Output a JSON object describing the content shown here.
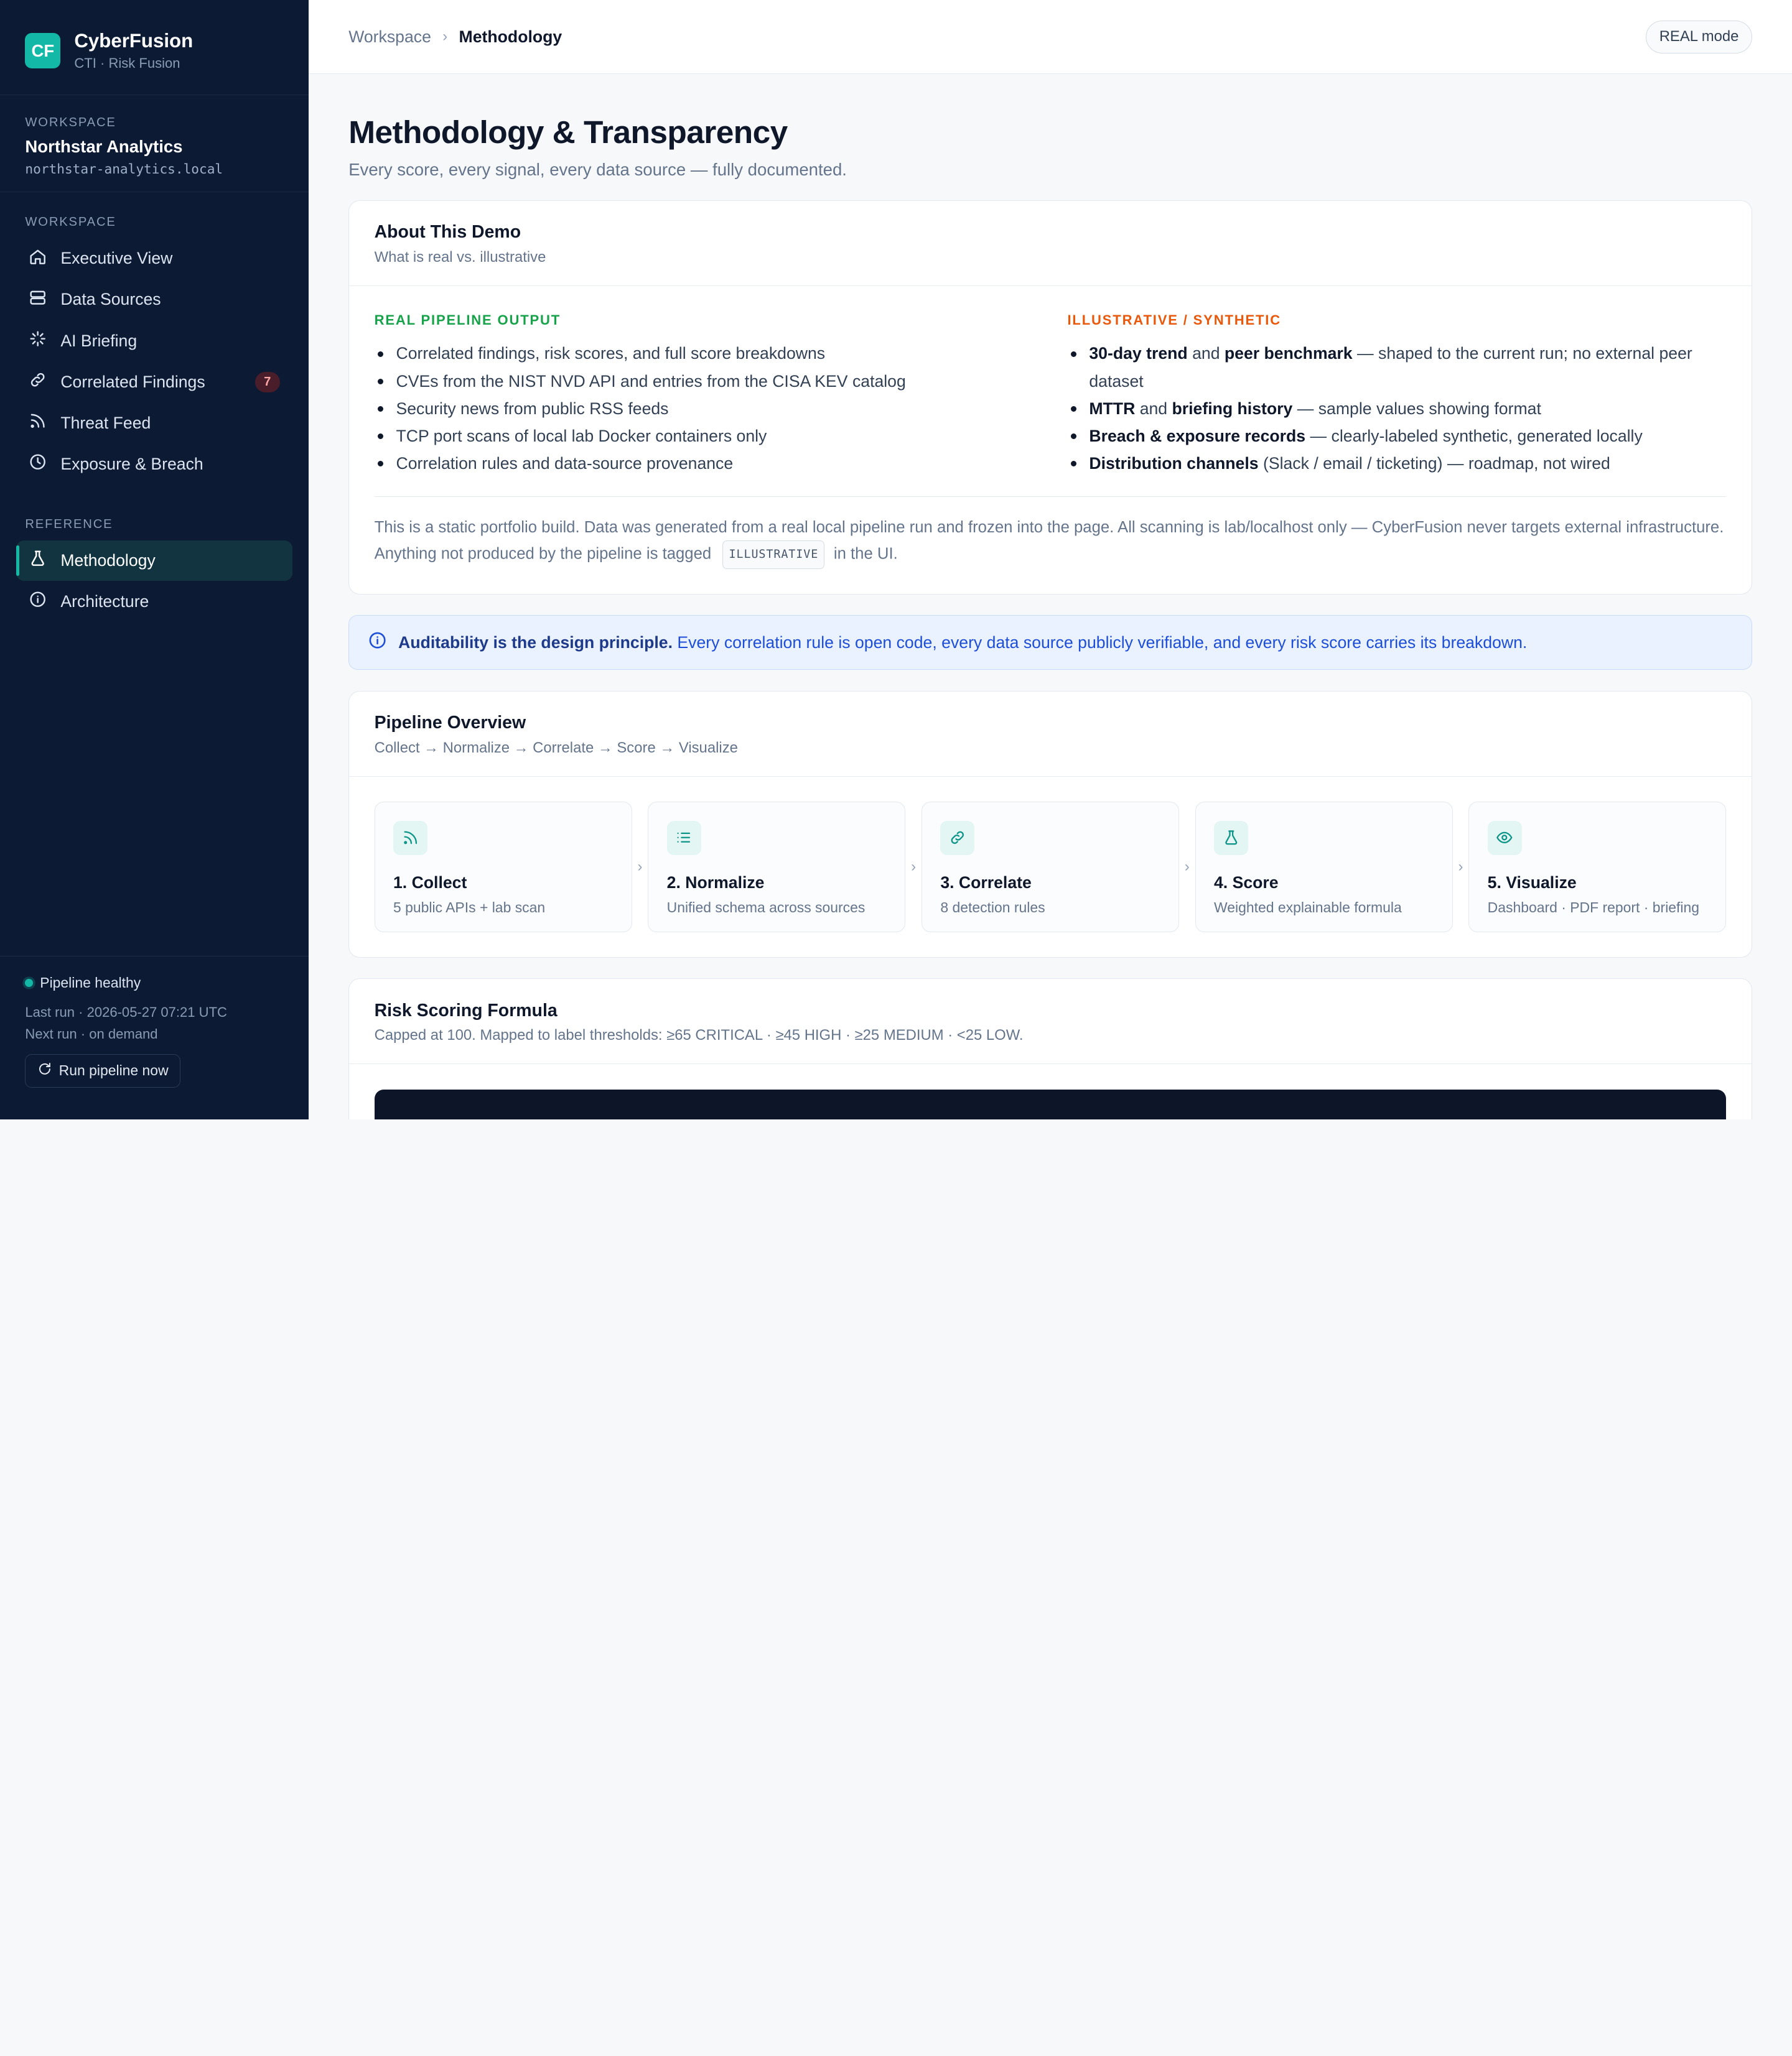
{
  "brand": {
    "logo": "CF",
    "name": "CyberFusion",
    "sub": "CTI · Risk Fusion"
  },
  "workspace": {
    "label": "WORKSPACE",
    "name": "Northstar Analytics",
    "domain": "northstar-analytics.local"
  },
  "nav": {
    "workspace_label": "WORKSPACE",
    "items": [
      {
        "label": "Executive View",
        "icon": "home-icon"
      },
      {
        "label": "Data Sources",
        "icon": "database-icon"
      },
      {
        "label": "AI Briefing",
        "icon": "sparkle-icon"
      },
      {
        "label": "Correlated Findings",
        "icon": "link-icon",
        "badge": "7"
      },
      {
        "label": "Threat Feed",
        "icon": "rss-icon"
      },
      {
        "label": "Exposure & Breach",
        "icon": "clock-icon"
      }
    ],
    "reference_label": "REFERENCE",
    "reference_items": [
      {
        "label": "Methodology",
        "icon": "flask-icon",
        "active": true
      },
      {
        "label": "Architecture",
        "icon": "info-icon"
      }
    ]
  },
  "footer": {
    "status": "Pipeline healthy",
    "last_run": "Last run · 2026-05-27 07:21 UTC",
    "next_run": "Next run · on demand",
    "run_button": "Run pipeline now"
  },
  "topbar": {
    "crumb_root": "Workspace",
    "crumb_current": "Methodology",
    "mode": "REAL mode"
  },
  "page": {
    "title": "Methodology & Transparency",
    "subtitle": "Every score, every signal, every data source — fully documented."
  },
  "about": {
    "title": "About This Demo",
    "subtitle": "What is real vs. illustrative",
    "real_label": "REAL PIPELINE OUTPUT",
    "real_items": [
      "Correlated findings, risk scores, and full score breakdowns",
      "CVEs from the NIST NVD API and entries from the CISA KEV catalog",
      "Security news from public RSS feeds",
      "TCP port scans of local lab Docker containers only",
      "Correlation rules and data-source provenance"
    ],
    "illus_label": "ILLUSTRATIVE / SYNTHETIC",
    "illus_items": [
      {
        "b1": "30-day trend",
        "m1": " and ",
        "b2": "peer benchmark",
        "rest": " — shaped to the current run; no external peer dataset"
      },
      {
        "b1": "MTTR",
        "m1": " and ",
        "b2": "briefing history",
        "rest": " — sample values showing format"
      },
      {
        "b1": "Breach & exposure records",
        "m1": "",
        "b2": "",
        "rest": " — clearly-labeled synthetic, generated locally"
      },
      {
        "b1": "Distribution channels",
        "m1": "",
        "b2": "",
        "rest": " (Slack / email / ticketing) — roadmap, not wired"
      }
    ],
    "note_part1": "This is a static portfolio build. Data was generated from a real local pipeline run and frozen into the page. All scanning is lab/localhost only — CyberFusion never targets external infrastructure. Anything not produced by the pipeline is tagged",
    "note_tag": "ILLUSTRATIVE",
    "note_part2": "in the UI."
  },
  "callout": {
    "bold": "Auditability is the design principle.",
    "text": " Every correlation rule is open code, every data source publicly verifiable, and every risk score carries its breakdown."
  },
  "pipeline": {
    "title": "Pipeline Overview",
    "subtitle": "Collect → Normalize → Correlate → Score → Visualize",
    "steps": [
      {
        "title": "1. Collect",
        "sub": "5 public APIs + lab scan",
        "icon": "rss-icon"
      },
      {
        "title": "2. Normalize",
        "sub": "Unified schema across sources",
        "icon": "list-icon"
      },
      {
        "title": "3. Correlate",
        "sub": "8 detection rules",
        "icon": "link-icon"
      },
      {
        "title": "4. Score",
        "sub": "Weighted explainable formula",
        "icon": "flask-icon"
      },
      {
        "title": "5. Visualize",
        "sub": "Dashboard · PDF report · briefing",
        "icon": "eye-icon"
      }
    ]
  },
  "risk": {
    "title": "Risk Scoring Formula",
    "subtitle": "Capped at 100. Mapped to label thresholds: ≥65 CRITICAL · ≥45 HIGH · ≥25 MEDIUM · <25 LOW."
  },
  "colors": {
    "accent": "#14b8a6",
    "sidebar": "#0c1a33",
    "real": "#16a34a",
    "illustrative": "#ea580c",
    "info": "#1d4ed8"
  }
}
